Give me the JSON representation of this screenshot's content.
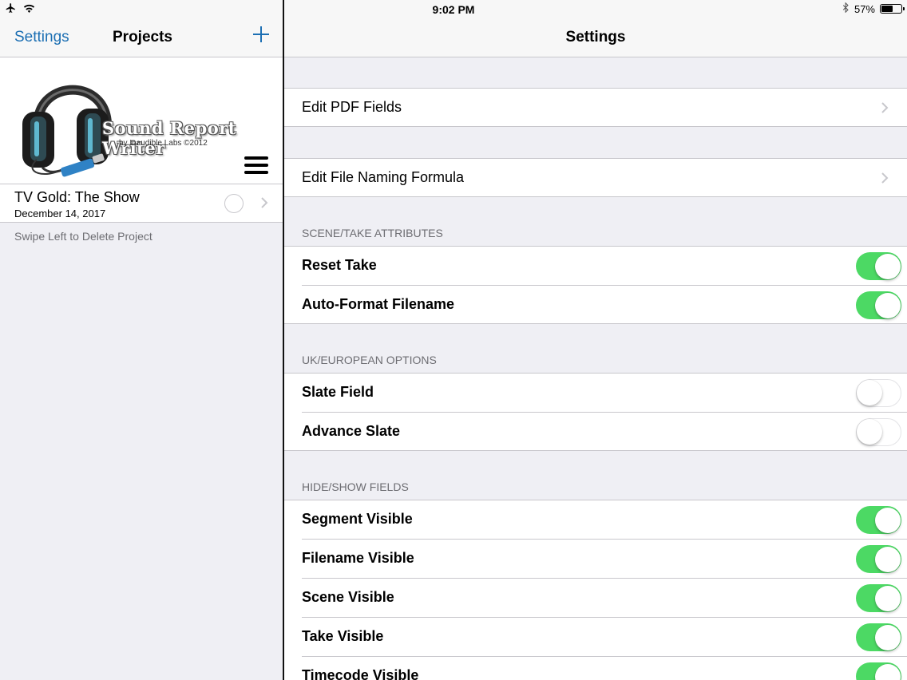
{
  "status_bar": {
    "time": "9:02 PM",
    "battery_text": "57%",
    "battery_level": 0.57,
    "icons": [
      "airplane-icon",
      "wifi-icon",
      "bluetooth-icon",
      "battery-icon"
    ]
  },
  "master": {
    "nav": {
      "back_label": "Settings",
      "title": "Projects",
      "add_icon": "plus-icon"
    },
    "logo": {
      "title": "Sound Report Writer",
      "subtitle": "by Inaudible Labs ©2012"
    },
    "projects": [
      {
        "name": "TV Gold: The Show",
        "date": "December 14, 2017"
      }
    ],
    "hint": "Swipe Left to Delete Project"
  },
  "detail": {
    "title": "Settings",
    "nav_rows": [
      {
        "label": "Edit PDF Fields"
      },
      {
        "label": "Edit File Naming Formula"
      }
    ],
    "sections": [
      {
        "header": "SCENE/TAKE ATTRIBUTES",
        "rows": [
          {
            "label": "Reset Take",
            "on": true
          },
          {
            "label": "Auto-Format Filename",
            "on": true
          }
        ]
      },
      {
        "header": "UK/EUROPEAN OPTIONS",
        "rows": [
          {
            "label": "Slate Field",
            "on": false
          },
          {
            "label": "Advance Slate",
            "on": false
          }
        ]
      },
      {
        "header": "HIDE/SHOW FIELDS",
        "rows": [
          {
            "label": "Segment Visible",
            "on": true
          },
          {
            "label": "Filename Visible",
            "on": true
          },
          {
            "label": "Scene Visible",
            "on": true
          },
          {
            "label": "Take Visible",
            "on": true
          },
          {
            "label": "Timecode Visible",
            "on": true
          }
        ]
      }
    ]
  },
  "colors": {
    "tint": "#1c6fb3",
    "switch_on": "#4cd964",
    "background": "#efeff4",
    "separator": "#c8c7cc"
  }
}
